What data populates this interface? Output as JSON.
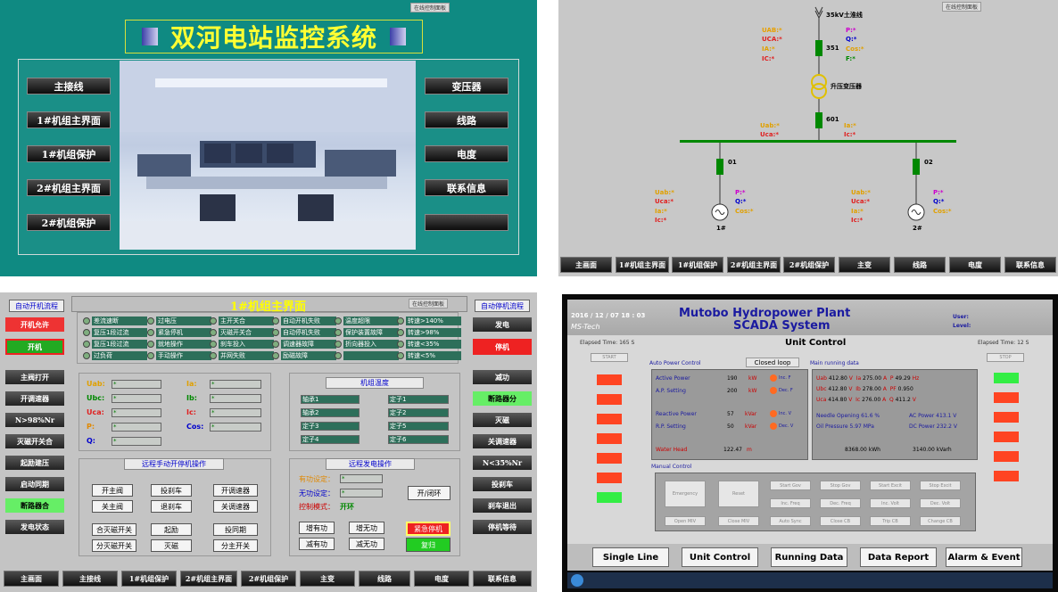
{
  "q1": {
    "title": "双河电站监控系统",
    "tag": "在线控制面板",
    "left_buttons": [
      "主接线",
      "1#机组主界面",
      "1#机组保护",
      "2#机组主界面",
      "2#机组保护"
    ],
    "right_buttons": [
      "变压器",
      "线路",
      "电度",
      "联系信息",
      ""
    ]
  },
  "q2": {
    "tag": "在线控制面板",
    "line": "35kV土淮线",
    "breaker351": "351",
    "transformer": "升压变压器",
    "breaker601": "601",
    "feeder01": "01",
    "feeder02": "02",
    "gen1": "1#",
    "gen2": "2#",
    "top_left": [
      "UAB:*",
      "UCA:*",
      "IA:*",
      "IC:*"
    ],
    "top_right": [
      "P:*",
      "Q:*",
      "Cos:*",
      "F:*"
    ],
    "mid_left": [
      "Uab:*",
      "Uca:*"
    ],
    "mid_right": [
      "Ia:*",
      "Ic:*"
    ],
    "g1_left": [
      "Uab:*",
      "Uca:*",
      "Ia:*",
      "Ic:*"
    ],
    "g1_right": [
      "P:*",
      "Q:*",
      "Cos:*"
    ],
    "g2_left": [
      "Uab:*",
      "Uca:*",
      "Ia:*",
      "Ic:*"
    ],
    "g2_right": [
      "P:*",
      "Q:*",
      "Cos:*"
    ],
    "nav": [
      "主画面",
      "1#机组主界面",
      "1#机组保护",
      "2#机组主界面",
      "2#机组保护",
      "主变",
      "线路",
      "电度",
      "联系信息"
    ]
  },
  "q3": {
    "title": "1#机组主界面",
    "tag": "在线控制面板",
    "left_header": "自动开机流程",
    "right_header": "自动停机流程",
    "left_buttons": [
      "开机允许",
      "开机",
      "主阀打开",
      "开调速器",
      "N>98%Nr",
      "灭磁开关合",
      "起励建压",
      "启动同期",
      "断路器合",
      "发电状态"
    ],
    "right_buttons": [
      "发电",
      "停机",
      "减功",
      "断路器分",
      "灭磁",
      "关调速器",
      "N<35%Nr",
      "投刹车",
      "刹车退出",
      "停机等待"
    ],
    "indicators": [
      [
        "差流速断",
        "过电压",
        "主开关合",
        "自动开机失败",
        "温度超限",
        "转速>140%"
      ],
      [
        "复压1段过流",
        "紧急停机",
        "灭磁开关合",
        "自动停机失败",
        "保护装置故障",
        "转速>98%"
      ],
      [
        "复压1段过流",
        "就地操作",
        "刹车投入",
        "调速器故障",
        "折向器投入",
        "转速<35%"
      ],
      [
        "过负荷",
        "手动操作",
        "并网失败",
        "励磁故障",
        "",
        "转速<5%"
      ]
    ],
    "elec_left": [
      "Uab:",
      "Ubc:",
      "Uca:",
      "P:",
      "Q:"
    ],
    "elec_right": [
      "Ia:",
      "Ib:",
      "Ic:",
      "Cos:"
    ],
    "elec_val": "*",
    "temp_title": "机组温度",
    "temp_left": [
      "轴承1",
      "轴承2",
      "定子3",
      "定子4"
    ],
    "temp_right": [
      "定子1",
      "定子2",
      "定子5",
      "定子6"
    ],
    "manual_title": "远程手动开停机操作",
    "manual": [
      [
        "开主阀",
        "投刹车",
        "开调速器"
      ],
      [
        "关主阀",
        "退刹车",
        "关调速器"
      ],
      [
        "合灭磁开关",
        "起励",
        "投同期"
      ],
      [
        "分灭磁开关",
        "灭磁",
        "分主开关"
      ]
    ],
    "power_title": "远程发电操作",
    "active_set": "有功设定：",
    "reactive_set": "无功设定：",
    "mode_label": "控制模式：",
    "mode_val": "开环",
    "toggle": "开/闭环",
    "power_btns": [
      [
        "增有功",
        "增无功"
      ],
      [
        "减有功",
        "减无功"
      ]
    ],
    "estop": "紧急停机",
    "reset": "复归",
    "nav": [
      "主画面",
      "主接线",
      "1#机组保护",
      "2#机组主界面",
      "2#机组保护",
      "主变",
      "线路",
      "电度",
      "联系信息"
    ]
  },
  "q4": {
    "title1": "Mutobo Hydropower Plant",
    "title2": "SCADA System",
    "date": "2016 / 12 / 07  18 : 03",
    "brand": "MS-Tech",
    "user": "User:",
    "level": "Level:",
    "unit_control": "Unit Control",
    "elapsed_left": "Elapsed Time: 165 S",
    "elapsed_right": "Elapsed Time: 12 S",
    "start": "START",
    "stop": "STOP",
    "apc": "Auto Power Control",
    "closed_loop": "Closed loop",
    "mrd": "Main running data",
    "apc_rows": [
      [
        "Active Power",
        "190",
        "kW",
        "Inc. F"
      ],
      [
        "A.P. Setting",
        "200",
        "kW",
        "Dec. F"
      ],
      [
        "Reactive Power",
        "57",
        "kVar",
        "Inc. V"
      ],
      [
        "R.P. Setting",
        "50",
        "kVar",
        "Dec. V"
      ],
      [
        "Water Head",
        "122.47",
        "m",
        ""
      ]
    ],
    "mrd_rows": [
      [
        "Uab",
        "412.80",
        "V",
        "Ia",
        "275.00",
        "A",
        "P",
        "49.29",
        "Hz"
      ],
      [
        "Ubc",
        "412.80",
        "V",
        "Ib",
        "278.00",
        "A",
        "PF",
        "0.950",
        ""
      ],
      [
        "Uca",
        "414.80",
        "V",
        "Ic",
        "276.00",
        "A",
        "Q",
        "411.2",
        "V"
      ]
    ],
    "needle": "Needle Opening  61.6  %",
    "ac_power": "AC Power  413.1  V",
    "oil": "Oil Pressure    5.97  MPa",
    "dc_power": "DC Power  232.2  V",
    "kwh": "8368.00  kWh",
    "kvarh": "3140.00  kVarh",
    "manual": "Manual Control",
    "big_btns": [
      "Emergency",
      "Reset"
    ],
    "grid": [
      [
        "Start Gov",
        "Stop Gov",
        "Start Excit",
        "Stop Excit"
      ],
      [
        "Inc. Freq",
        "Dec. Freq",
        "Inc. Volt",
        "Dec. Volt"
      ],
      [
        "Open MIV",
        "Close MIV",
        "Auto Sync",
        "Close CB",
        "Trip CB",
        "Change CB"
      ]
    ],
    "nav": [
      "Single Line",
      "Unit Control",
      "Running Data",
      "Data Report",
      "Alarm & Event"
    ],
    "colors": {
      "red": "#ff4422",
      "green": "#33ee44",
      "title": "#1a1aa0"
    }
  }
}
